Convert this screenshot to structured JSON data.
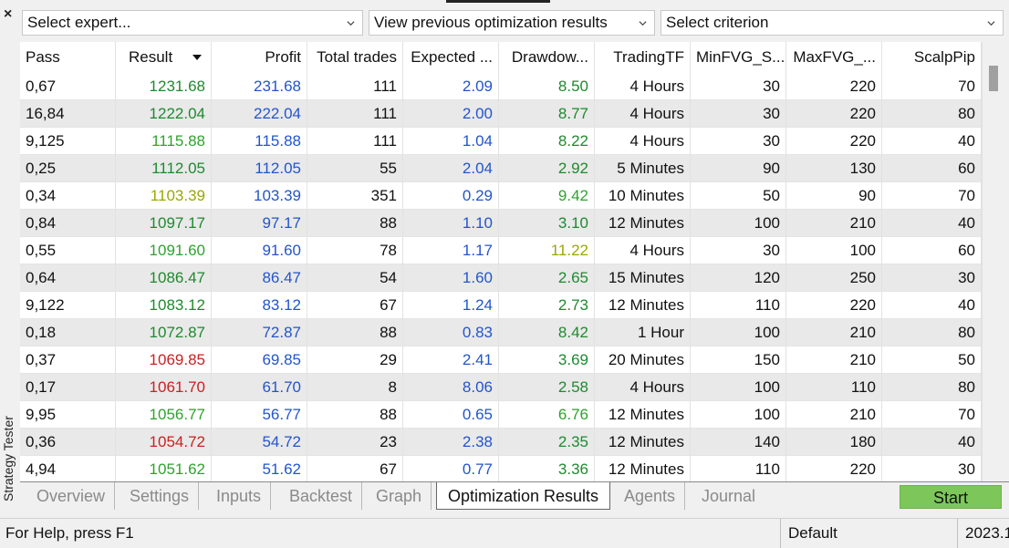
{
  "side": {
    "close": "×",
    "title": "Strategy Tester"
  },
  "dropdowns": {
    "expert": "Select expert...",
    "previous": "View previous optimization results",
    "criterion": "Select criterion"
  },
  "table": {
    "headers": [
      "Pass",
      "Result",
      "Profit",
      "Total trades",
      "Expected ...",
      "Drawdow...",
      "TradingTF",
      "MinFVG_S...",
      "MaxFVG_...",
      "ScalpPip"
    ],
    "rows": [
      [
        "0,67",
        "1231.68",
        "231.68",
        "111",
        "2.09",
        "8.50",
        "4 Hours",
        "30",
        "220",
        "70"
      ],
      [
        "16,84",
        "1222.04",
        "222.04",
        "111",
        "2.00",
        "8.77",
        "4 Hours",
        "30",
        "220",
        "80"
      ],
      [
        "9,125",
        "1115.88",
        "115.88",
        "111",
        "1.04",
        "8.22",
        "4 Hours",
        "30",
        "220",
        "40"
      ],
      [
        "0,25",
        "1112.05",
        "112.05",
        "55",
        "2.04",
        "2.92",
        "5 Minutes",
        "90",
        "130",
        "60"
      ],
      [
        "0,34",
        "1103.39",
        "103.39",
        "351",
        "0.29",
        "9.42",
        "10 Minutes",
        "50",
        "90",
        "70"
      ],
      [
        "0,84",
        "1097.17",
        "97.17",
        "88",
        "1.10",
        "3.10",
        "12 Minutes",
        "100",
        "210",
        "40"
      ],
      [
        "0,55",
        "1091.60",
        "91.60",
        "78",
        "1.17",
        "11.22",
        "4 Hours",
        "30",
        "100",
        "60"
      ],
      [
        "0,64",
        "1086.47",
        "86.47",
        "54",
        "1.60",
        "2.65",
        "15 Minutes",
        "120",
        "250",
        "30"
      ],
      [
        "9,122",
        "1083.12",
        "83.12",
        "67",
        "1.24",
        "2.73",
        "12 Minutes",
        "110",
        "220",
        "40"
      ],
      [
        "0,18",
        "1072.87",
        "72.87",
        "88",
        "0.83",
        "8.42",
        "1 Hour",
        "100",
        "210",
        "80"
      ],
      [
        "0,37",
        "1069.85",
        "69.85",
        "29",
        "2.41",
        "3.69",
        "20 Minutes",
        "150",
        "210",
        "50"
      ],
      [
        "0,17",
        "1061.70",
        "61.70",
        "8",
        "8.06",
        "2.58",
        "4 Hours",
        "100",
        "110",
        "80"
      ],
      [
        "9,95",
        "1056.77",
        "56.77",
        "88",
        "0.65",
        "6.76",
        "12 Minutes",
        "100",
        "210",
        "70"
      ],
      [
        "0,36",
        "1054.72",
        "54.72",
        "23",
        "2.38",
        "2.35",
        "12 Minutes",
        "140",
        "180",
        "40"
      ],
      [
        "4,94",
        "1051.62",
        "51.62",
        "67",
        "0.77",
        "3.36",
        "12 Minutes",
        "110",
        "220",
        "30"
      ]
    ],
    "result_colors": [
      "#1e8a2e",
      "#1e8a2e",
      "#2ea32e",
      "#1e8a2e",
      "#9aa800",
      "#1e8a2e",
      "#2ea32e",
      "#1e8a2e",
      "#1e8a2e",
      "#1e8a2e",
      "#cc2020",
      "#cc2020",
      "#2ea32e",
      "#cc2020",
      "#2ea32e"
    ],
    "drawdown_colors": [
      "#1e8a2e",
      "#1e8a2e",
      "#1e8a2e",
      "#1e8a2e",
      "#2ea32e",
      "#1e8a2e",
      "#9aa800",
      "#1e8a2e",
      "#1e8a2e",
      "#1e8a2e",
      "#1e8a2e",
      "#1e8a2e",
      "#2ea32e",
      "#1e8a2e",
      "#1e8a2e"
    ],
    "blue": "#2255cc"
  },
  "tabs": [
    "Overview",
    "Settings",
    "Inputs",
    "Backtest",
    "Graph",
    "Optimization Results",
    "Agents",
    "Journal"
  ],
  "active_tab": "Optimization Results",
  "start_label": "Start",
  "status": {
    "help": "For Help, press F1",
    "profile": "Default",
    "date": "2023.1"
  }
}
